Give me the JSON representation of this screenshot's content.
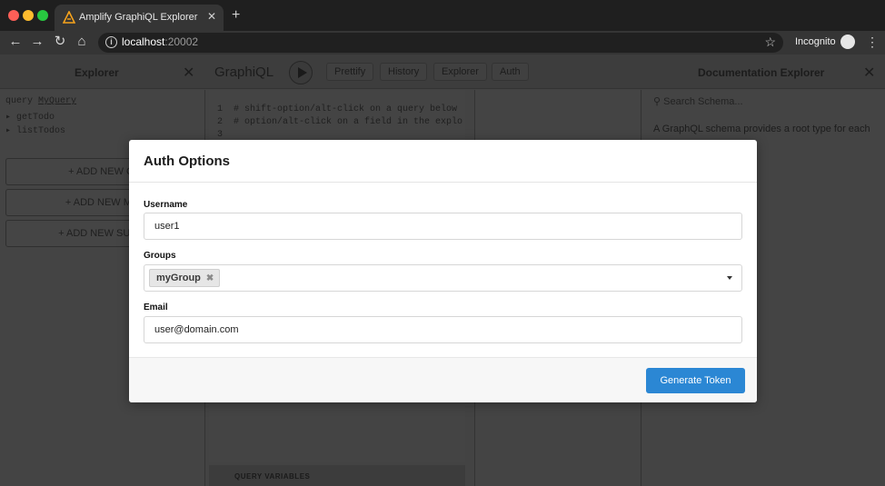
{
  "browser": {
    "tab_title": "Amplify GraphiQL Explorer",
    "url_host": "localhost",
    "url_port": ":20002",
    "profile_label": "Incognito",
    "icons": [
      "back-arrow-icon",
      "forward-arrow-icon",
      "reload-icon",
      "home-icon",
      "info-icon",
      "bookmark-star-icon",
      "incognito-icon",
      "more-menu-icon"
    ]
  },
  "explorer": {
    "title": "Explorer",
    "query_keyword": "query",
    "query_name": "MyQuery",
    "fields": [
      "getTodo",
      "listTodos"
    ],
    "add_query_label": "+ ADD NEW QUE",
    "add_mutation_label": "+ ADD NEW MUTA",
    "add_subscription_label": "+ ADD NEW SUBSCR"
  },
  "graphiql": {
    "title": "GraphiQL",
    "buttons": [
      "Prettify",
      "History",
      "Explorer",
      "Auth"
    ],
    "editor_lines": [
      {
        "num": "1",
        "text": "# shift-option/alt-click on a query below"
      },
      {
        "num": "2",
        "text": "# option/alt-click on a field in the explo"
      },
      {
        "num": "3",
        "text": ""
      }
    ],
    "query_variables_label": "QUERY VARIABLES"
  },
  "docs": {
    "title": "Documentation Explorer",
    "search_placeholder": "Search Schema...",
    "intro": "A GraphQL schema provides a root type for each"
  },
  "modal": {
    "title": "Auth Options",
    "username_label": "Username",
    "username_value": "user1",
    "groups_label": "Groups",
    "groups": [
      "myGroup"
    ],
    "email_label": "Email",
    "email_value": "user@domain.com",
    "generate_label": "Generate Token",
    "accent_color": "#2b87d4"
  }
}
